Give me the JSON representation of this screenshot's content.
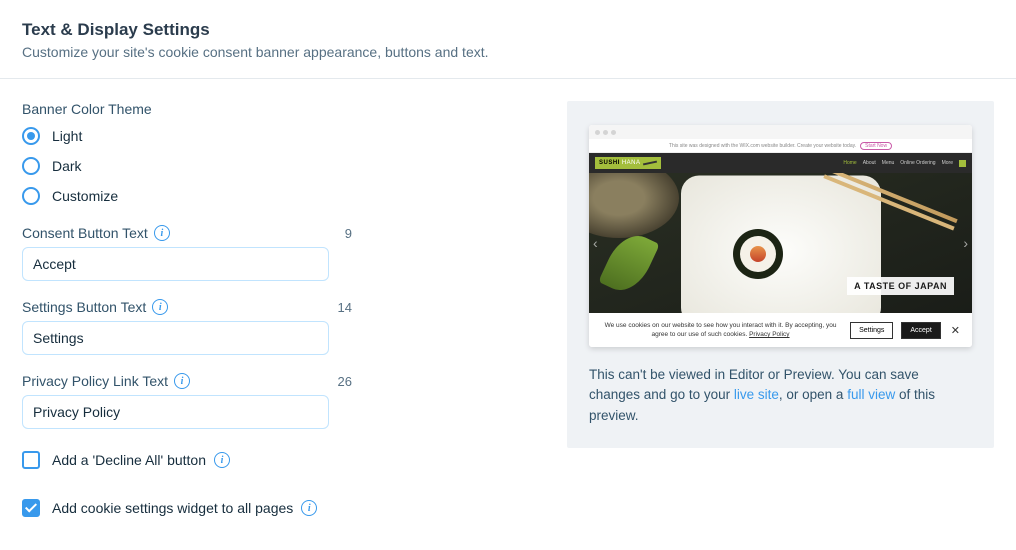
{
  "header": {
    "title": "Text & Display Settings",
    "subtitle": "Customize your site's cookie consent banner appearance, buttons and text."
  },
  "theme": {
    "label": "Banner Color Theme",
    "options": [
      "Light",
      "Dark",
      "Customize"
    ],
    "selected": "Light"
  },
  "fields": {
    "consent": {
      "label": "Consent Button Text",
      "value": "Accept",
      "count": "9"
    },
    "settings": {
      "label": "Settings Button Text",
      "value": "Settings",
      "count": "14"
    },
    "privacy": {
      "label": "Privacy Policy Link Text",
      "value": "Privacy Policy",
      "count": "26"
    }
  },
  "checks": {
    "decline": {
      "label": "Add a 'Decline All' button",
      "checked": false
    },
    "widget": {
      "label": "Add cookie settings widget to all pages",
      "checked": true
    }
  },
  "preview": {
    "wix_bar": "This site was designed with the WIX.com website builder. Create your website today.",
    "start_now": "Start Now",
    "brand_a": "SUSHI",
    "brand_b": "HANA",
    "nav": {
      "home": "Home",
      "about": "About",
      "menu": "Menu",
      "order": "Online Ordering",
      "more": "More"
    },
    "hero_tag": "A TASTE OF JAPAN",
    "cookie_text_1": "We use cookies on our website to see how you interact with it. By accepting, you agree to our use of such cookies. ",
    "cookie_link": "Privacy Policy",
    "btn_settings": "Settings",
    "btn_accept": "Accept",
    "note_1": "This can't be viewed in Editor or Preview. You can save changes and go to your ",
    "link_live": "live site",
    "note_2": ", or open a ",
    "link_full": "full view",
    "note_3": " of this preview."
  }
}
